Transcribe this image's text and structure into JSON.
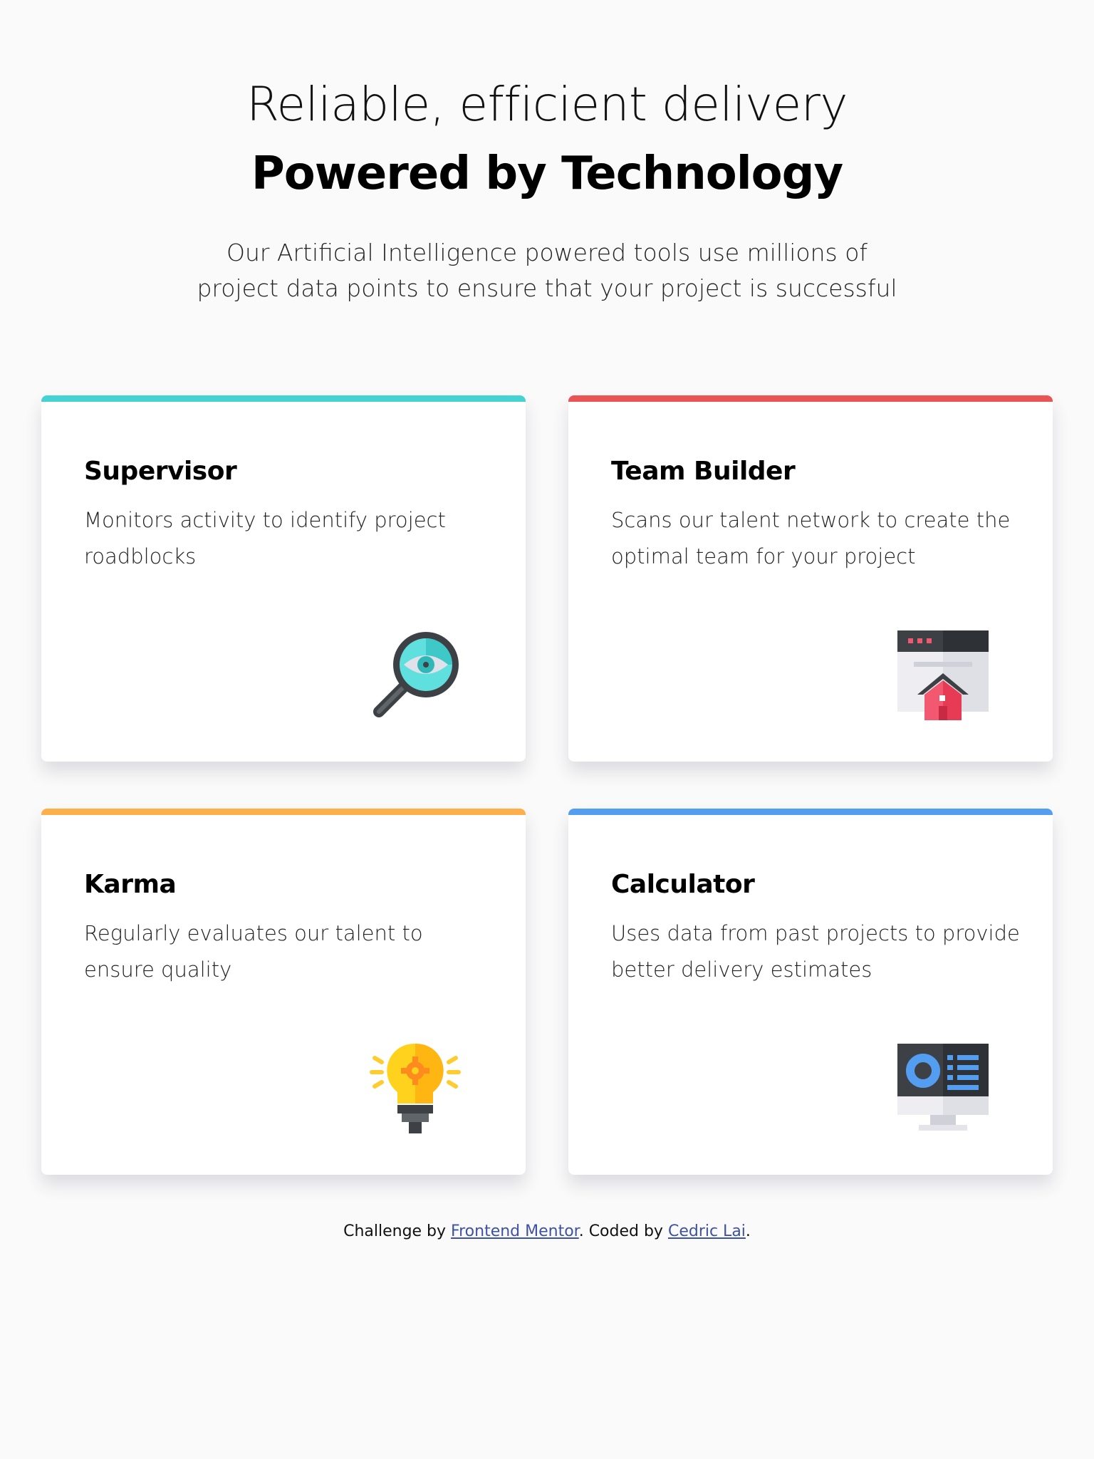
{
  "header": {
    "title_light": "Reliable, efficient delivery",
    "title_bold": "Powered by Technology",
    "intro": "Our Artificial Intelligence powered tools use millions of project data points to ensure that your project is successful"
  },
  "cards": [
    {
      "title": "Supervisor",
      "text": "Monitors activity to identify project roadblocks",
      "accent": "#44d3d2",
      "icon": "magnifier-eye-icon"
    },
    {
      "title": "Team Builder",
      "text": "Scans our talent network to create the optimal team for your project",
      "accent": "#ea5454",
      "icon": "browser-house-icon"
    },
    {
      "title": "Karma",
      "text": "Regularly evaluates our talent to ensure quality",
      "accent": "#fcaf4a",
      "icon": "lightbulb-gear-icon"
    },
    {
      "title": "Calculator",
      "text": "Uses data from past projects to provide better delivery estimates",
      "accent": "#549ef2",
      "icon": "monitor-dashboard-icon"
    }
  ],
  "footer": {
    "prefix": "Challenge by ",
    "link1": "Frontend Mentor",
    "middle": ". Coded by ",
    "link2": "Cedric Lai",
    "suffix": "."
  }
}
